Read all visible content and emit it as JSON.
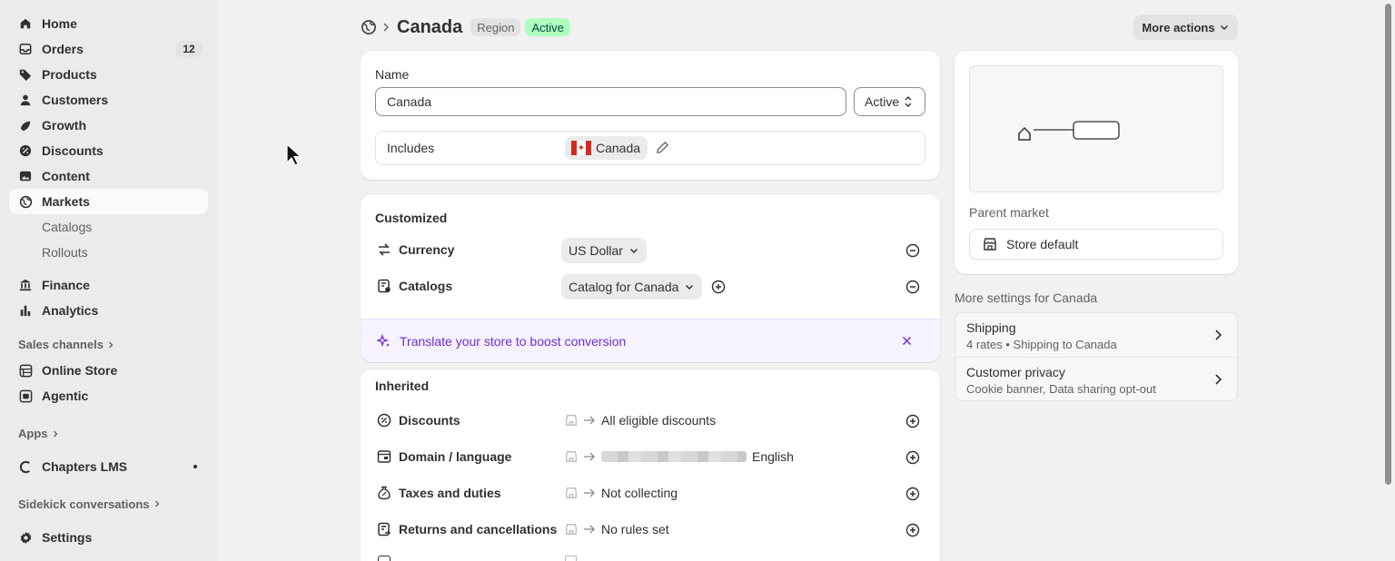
{
  "sidebar": {
    "items": [
      {
        "label": "Home",
        "icon": "home-icon"
      },
      {
        "label": "Orders",
        "icon": "inbox-icon",
        "badge": "12"
      },
      {
        "label": "Products",
        "icon": "tag-icon"
      },
      {
        "label": "Customers",
        "icon": "person-icon"
      },
      {
        "label": "Growth",
        "icon": "growth-icon"
      },
      {
        "label": "Discounts",
        "icon": "discount-icon"
      },
      {
        "label": "Content",
        "icon": "image-icon"
      },
      {
        "label": "Markets",
        "icon": "globe-icon"
      }
    ],
    "markets_sub": [
      "Catalogs",
      "Rollouts"
    ],
    "items2": [
      {
        "label": "Finance",
        "icon": "bank-icon"
      },
      {
        "label": "Analytics",
        "icon": "bar-chart-icon"
      }
    ],
    "sales_channels": "Sales channels",
    "channels": [
      {
        "label": "Online Store",
        "icon": "store-icon"
      },
      {
        "label": "Agentic",
        "icon": "agent-icon"
      }
    ],
    "apps": "Apps",
    "app_items": [
      {
        "label": "Chapters LMS",
        "icon": "chapters-icon"
      }
    ],
    "sidekick": "Sidekick conversations",
    "settings": "Settings"
  },
  "header": {
    "title": "Canada",
    "tag_region": "Region",
    "tag_status": "Active",
    "more_actions": "More actions"
  },
  "name_card": {
    "name_label": "Name",
    "name_value": "Canada",
    "status_select": "Active",
    "includes_label": "Includes",
    "includes_chip": "Canada"
  },
  "customized": {
    "heading": "Customized",
    "currency_label": "Currency",
    "currency_value": "US Dollar",
    "catalogs_label": "Catalogs",
    "catalogs_value": "Catalog for Canada",
    "banner_text": "Translate your store to boost conversion"
  },
  "inherited": {
    "heading": "Inherited",
    "rows": [
      {
        "label": "Discounts",
        "value": "All eligible discounts"
      },
      {
        "label": "Domain / language",
        "value": "English"
      },
      {
        "label": "Taxes and duties",
        "value": "Not collecting"
      },
      {
        "label": "Returns and cancellations",
        "value": "No rules set"
      }
    ]
  },
  "side_card": {
    "parent_market_label": "Parent market",
    "parent_market_value": "Store default"
  },
  "more_settings": {
    "heading": "More settings for Canada",
    "rows": [
      {
        "title": "Shipping",
        "subtitle": "4 rates • Shipping to Canada"
      },
      {
        "title": "Customer privacy",
        "subtitle": "Cookie banner, Data sharing opt-out"
      }
    ]
  },
  "colors": {
    "active_badge": "#affebf",
    "banner_text": "#6b2fd1",
    "sidebar_bg": "#ebebeb"
  }
}
